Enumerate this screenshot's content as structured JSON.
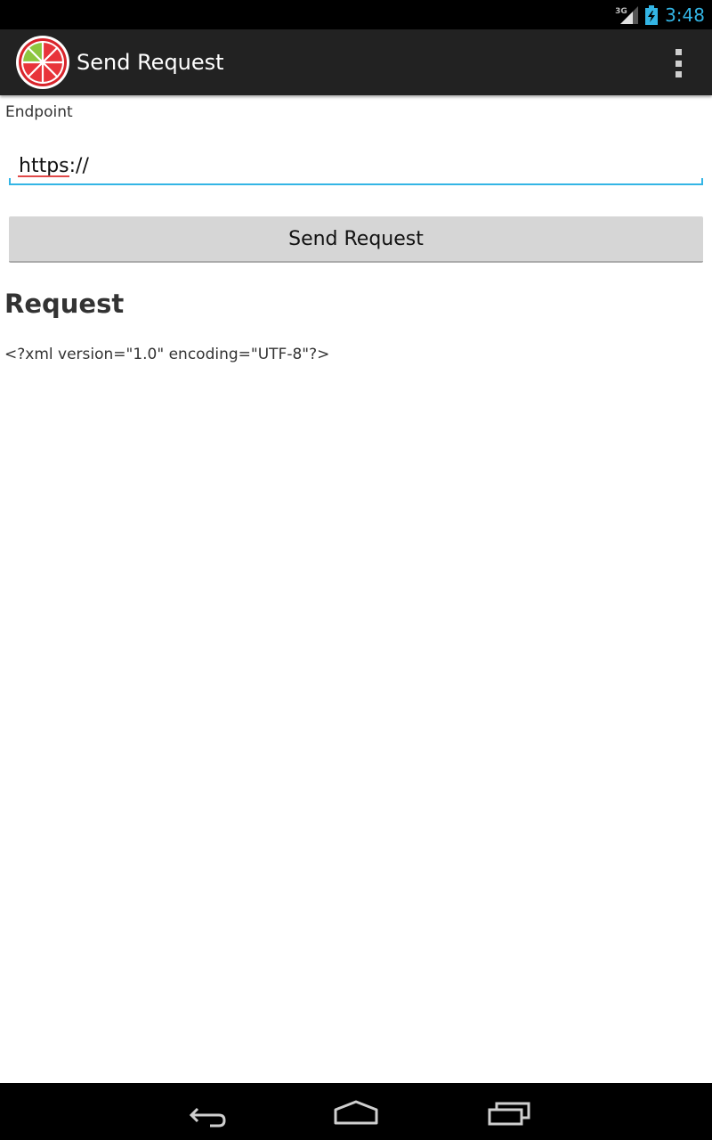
{
  "status_bar": {
    "network_type": "3G",
    "time": "3:48",
    "icons": [
      "signal-icon",
      "battery-charging-icon"
    ],
    "clock_color": "#33b5e5"
  },
  "action_bar": {
    "title": "Send Request",
    "app_icon": "lime-slice-icon",
    "overflow_icon": "overflow-menu-icon"
  },
  "form": {
    "endpoint_label": "Endpoint",
    "endpoint_value": "https://",
    "send_button_label": "Send Request",
    "accent_color": "#33b5e5"
  },
  "request": {
    "heading": "Request",
    "body": "<?xml version=\"1.0\" encoding=\"UTF-8\"?>"
  },
  "nav_bar": {
    "icons": [
      "back-icon",
      "home-icon",
      "recent-apps-icon"
    ]
  }
}
